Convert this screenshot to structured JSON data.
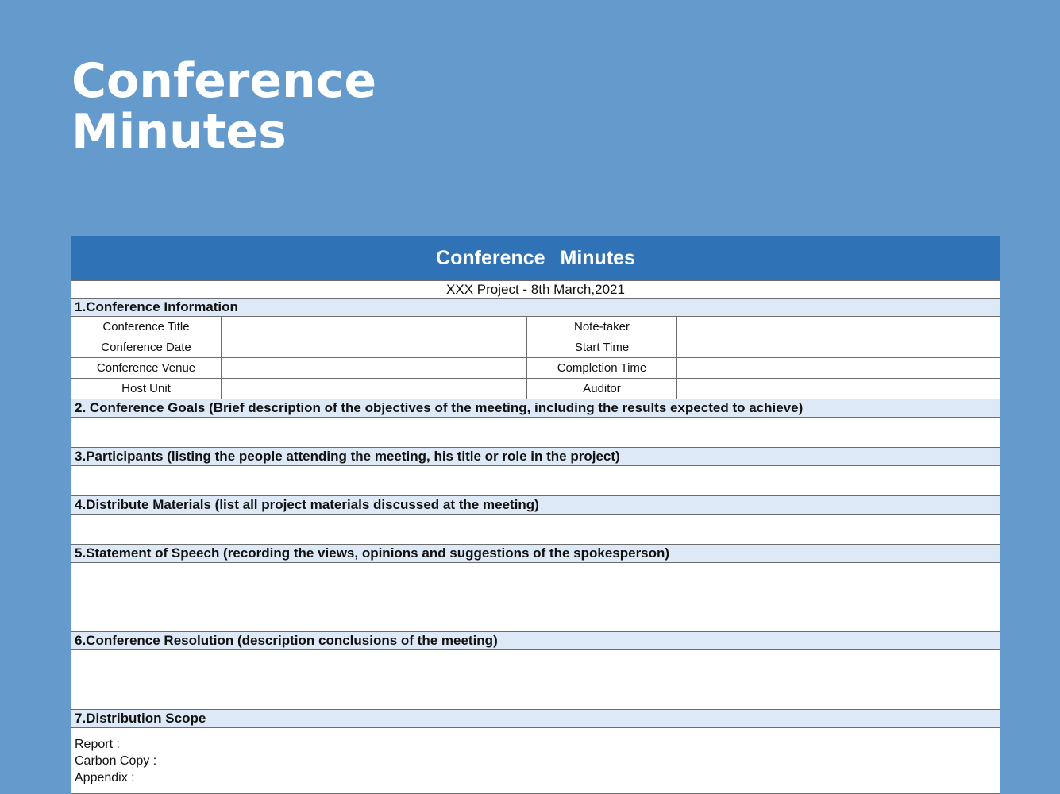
{
  "page_title_line1": "Conference",
  "page_title_line2": "Minutes",
  "doc": {
    "header": "Conference Minutes",
    "subtitle": "XXX Project - 8th March,2021",
    "sections": [
      "1.Conference Information",
      "2. Conference Goals (Brief description of the objectives of the meeting, including the results expected to achieve)",
      "3.Participants (listing the people attending the meeting, his title or role in the project)",
      "4.Distribute Materials (list all project materials discussed at the meeting)",
      "5.Statement of  Speech (recording the views, opinions and suggestions of the spokesperson)",
      "6.Conference Resolution (description conclusions of the meeting)",
      "7.Distribution Scope"
    ],
    "info_rows": [
      {
        "left": "Conference Title",
        "right": "Note-taker"
      },
      {
        "left": "Conference Date",
        "right": "Start Time"
      },
      {
        "left": "Conference Venue",
        "right": "Completion Time"
      },
      {
        "left": "Host Unit",
        "right": "Auditor"
      }
    ],
    "distribution": [
      "Report :",
      "Carbon Copy :",
      "Appendix :"
    ]
  },
  "colors": {
    "background": "#659bcc",
    "header": "#2f72b5",
    "section": "#dde9f6"
  }
}
